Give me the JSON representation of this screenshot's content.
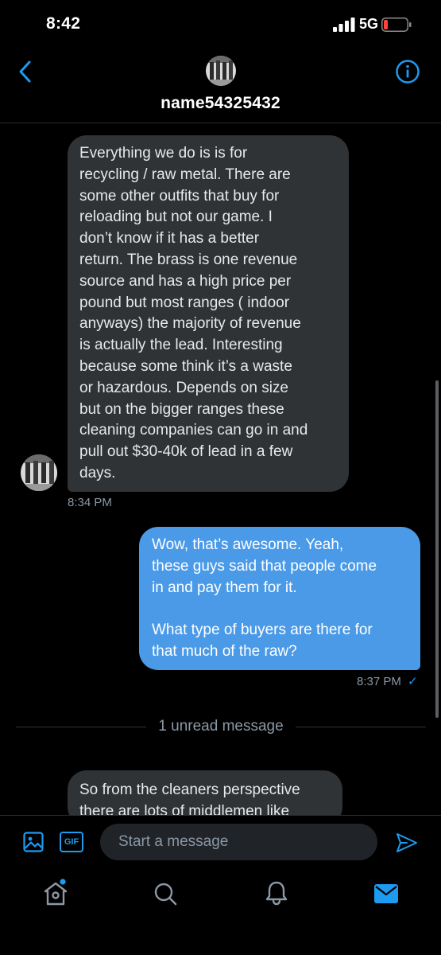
{
  "status_bar": {
    "time": "8:42",
    "network": "5G"
  },
  "header": {
    "username": "name54325432"
  },
  "messages": [
    {
      "direction": "incoming",
      "text": "Everything we do is is for\nrecycling / raw metal. There are\nsome other outfits that buy for\nreloading but not our game. I\ndon’t know if it has a better\nreturn. The brass is one revenue\nsource and has a high price per\npound but most ranges ( indoor\nanyways) the majority of revenue\nis actually the lead. Interesting\nbecause some think it’s a waste\nor hazardous. Depends on size\nbut on the bigger ranges these\ncleaning companies can go in and\npull out $30-40k of lead in a few\ndays.",
      "time": "8:34 PM"
    },
    {
      "direction": "outgoing",
      "text": "Wow, that’s awesome. Yeah,\nthese guys said that people come\nin and pay them for it.\n\nWhat type of buyers are there for\nthat much of the raw?",
      "time": "8:37 PM",
      "status": "✓"
    },
    {
      "direction": "incoming",
      "text": "So from the cleaners perspective\nthere are lots of middlemen like"
    }
  ],
  "unread_divider": "1 unread message",
  "composer": {
    "gif_label": "GIF",
    "placeholder": "Start a message"
  },
  "icons": {
    "back": "chevron-left-icon",
    "info": "info-icon",
    "media": "image-icon",
    "gif": "gif-icon",
    "send": "send-icon",
    "home": "home-icon",
    "search": "search-icon",
    "notifications": "bell-icon",
    "messages": "envelope-icon"
  },
  "colors": {
    "accent": "#1d9bf0",
    "outgoing_bubble": "#4a9ae8",
    "incoming_bubble": "#2f3336",
    "background": "#000000",
    "secondary_text": "#8b98a5"
  }
}
